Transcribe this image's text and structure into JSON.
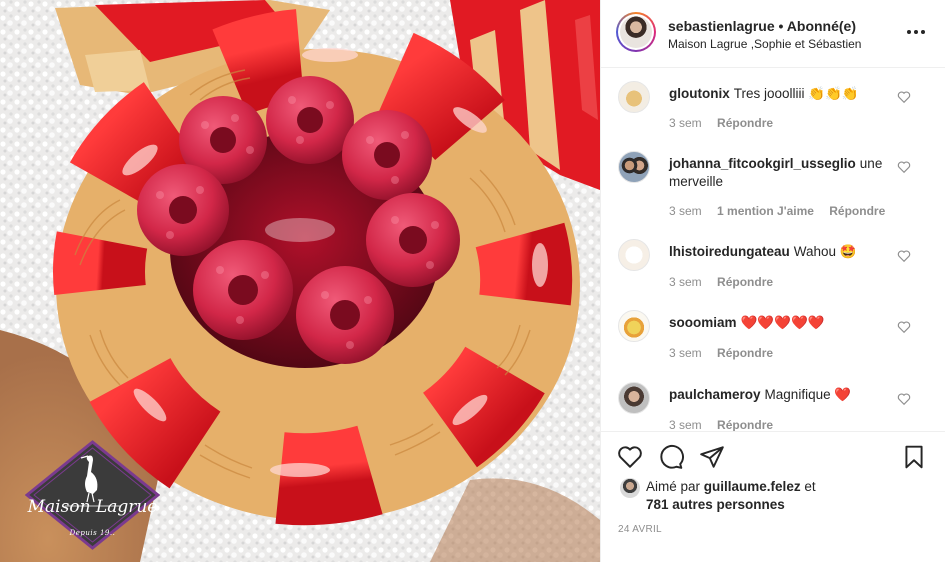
{
  "photo": {
    "alt_logo_name": "Maison Lagrue",
    "alt_logo_since": "Depuis 19..",
    "colors": {
      "glaze": "#e3141f",
      "pastry": "#e8b86a",
      "raspberry": "#d8263e",
      "sugar": "#f2f2f2"
    }
  },
  "header": {
    "username": "sebastienlagrue",
    "follow_state": "Abonné(e)",
    "separator": "•",
    "subtitle": "Maison Lagrue ,Sophie et Sébastien"
  },
  "comments": [
    {
      "username": "gloutonix",
      "text": "Tres jooolliii 👏👏👏",
      "time": "3 sem",
      "likes": "",
      "reply": "Répondre",
      "avatar_icon": "food-photo-avatar"
    },
    {
      "username": "johanna_fitcookgirl_usseglio",
      "text": "une merveille",
      "time": "3 sem",
      "likes": "1 mention J'aime",
      "reply": "Répondre",
      "avatar_icon": "couple-photo-avatar"
    },
    {
      "username": "lhistoiredungateau",
      "text": "Wahou 🤩",
      "time": "3 sem",
      "likes": "",
      "reply": "Répondre",
      "avatar_icon": "logo-avatar"
    },
    {
      "username": "sooomiam",
      "text": "❤️❤️❤️❤️❤️",
      "time": "3 sem",
      "likes": "",
      "reply": "Répondre",
      "avatar_icon": "cake-photo-avatar"
    },
    {
      "username": "paulchameroy",
      "text": "Magnifique ❤️",
      "time": "3 sem",
      "likes": "",
      "reply": "Répondre",
      "avatar_icon": "portrait-avatar"
    }
  ],
  "actions": {
    "liked_prefix": "Aimé par",
    "liked_user": "guillaume.felez",
    "liked_and": "et",
    "liked_others": "781 autres personnes",
    "date": "24 AVRIL"
  }
}
